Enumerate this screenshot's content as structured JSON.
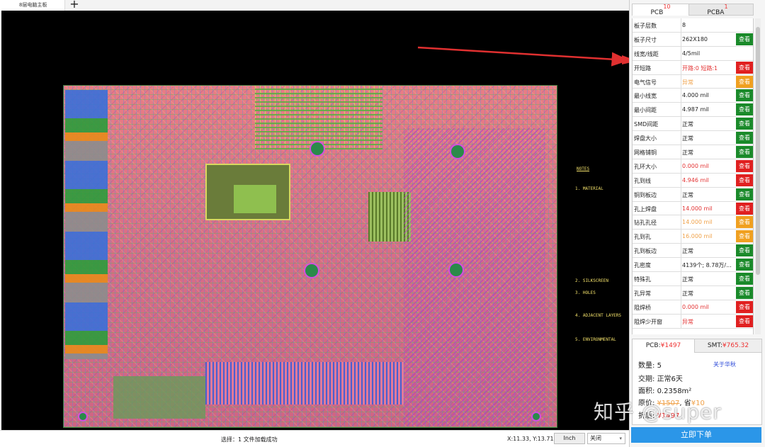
{
  "document_tab": {
    "title": "8层电脑主板"
  },
  "add_tab_label": "+",
  "silkscreen_notes": [
    "NOTES",
    "1. MATERIAL",
    "2. SILKSCREEN",
    "3. HOLES",
    "4. ADJACENT LAYERS",
    "5. ENVIRONMENTAL"
  ],
  "status": {
    "message": "选择：1  文件加载成功",
    "coords": "X:11.33, Y:13.71",
    "unit_button": "Inch",
    "dropdown_value": "关闭",
    "dropdown_arrow": "▾"
  },
  "panel_tabs": [
    {
      "label": "PCB",
      "count": "10"
    },
    {
      "label": "PCBA",
      "count": "1"
    }
  ],
  "check_rows": [
    {
      "label": "板子层数",
      "value": "8",
      "value_color": "#222222",
      "button": "",
      "button_color": ""
    },
    {
      "label": "板子尺寸",
      "value": "262X180",
      "value_color": "#222222",
      "button": "查看",
      "button_color": "#1a8a2a"
    },
    {
      "label": "线宽/线距",
      "value": "4/5mil",
      "value_color": "#222222",
      "button": "",
      "button_color": ""
    },
    {
      "label": "开短路",
      "value": "开路:0  短路:1",
      "value_color": "#e33333",
      "button": "查看",
      "button_color": "#e02020"
    },
    {
      "label": "电气信号",
      "value": "异常",
      "value_color": "#f0a24a",
      "button": "查看",
      "button_color": "#f0a020"
    },
    {
      "label": "最小线宽",
      "value": "4.000 mil",
      "value_color": "#222222",
      "button": "查看",
      "button_color": "#1a8a2a"
    },
    {
      "label": "最小间距",
      "value": "4.987 mil",
      "value_color": "#222222",
      "button": "查看",
      "button_color": "#1a8a2a"
    },
    {
      "label": "SMD间距",
      "value": "正常",
      "value_color": "#222222",
      "button": "查看",
      "button_color": "#1a8a2a"
    },
    {
      "label": "焊盘大小",
      "value": "正常",
      "value_color": "#222222",
      "button": "查看",
      "button_color": "#1a8a2a"
    },
    {
      "label": "网格铺铜",
      "value": "正常",
      "value_color": "#222222",
      "button": "查看",
      "button_color": "#1a8a2a"
    },
    {
      "label": "孔环大小",
      "value": "0.000 mil",
      "value_color": "#e33333",
      "button": "查看",
      "button_color": "#e02020"
    },
    {
      "label": "孔到线",
      "value": "4.946 mil",
      "value_color": "#e33333",
      "button": "查看",
      "button_color": "#e02020"
    },
    {
      "label": "铜到板边",
      "value": "正常",
      "value_color": "#222222",
      "button": "查看",
      "button_color": "#1a8a2a"
    },
    {
      "label": "孔上焊盘",
      "value": "14.000 mil",
      "value_color": "#e33333",
      "button": "查看",
      "button_color": "#e02020"
    },
    {
      "label": "钻孔孔径",
      "value": "14.000 mil",
      "value_color": "#f0a24a",
      "button": "查看",
      "button_color": "#f0a020"
    },
    {
      "label": "孔到孔",
      "value": "16.000 mil",
      "value_color": "#f0a24a",
      "button": "查看",
      "button_color": "#f0a020"
    },
    {
      "label": "孔到板边",
      "value": "正常",
      "value_color": "#222222",
      "button": "查看",
      "button_color": "#1a8a2a"
    },
    {
      "label": "孔密度",
      "value": "4139个; 8.78万/...",
      "value_color": "#222222",
      "button": "查看",
      "button_color": "#1a8a2a"
    },
    {
      "label": "特殊孔",
      "value": "正常",
      "value_color": "#222222",
      "button": "查看",
      "button_color": "#1a8a2a"
    },
    {
      "label": "孔异常",
      "value": "正常",
      "value_color": "#222222",
      "button": "查看",
      "button_color": "#1a8a2a"
    },
    {
      "label": "阻焊桥",
      "value": "0.000 mil",
      "value_color": "#e33333",
      "button": "查看",
      "button_color": "#e02020"
    },
    {
      "label": "阻焊少开窗",
      "value": "异常",
      "value_color": "#e33333",
      "button": "查看",
      "button_color": "#e02020"
    }
  ],
  "price": {
    "tab_pcb_label": "PCB:",
    "tab_pcb_value": "¥1497",
    "tab_smt_label": "SMT:",
    "tab_smt_value": "¥765.32",
    "quantity_label": "数量:",
    "quantity": "5",
    "about_link": "关于华秋",
    "delivery_label": "交期:",
    "delivery": "正常6天",
    "area_label": "面积:",
    "area": "0.2358m²",
    "orig_label": "原价:",
    "orig_price": "¥1507",
    "save_label": "省",
    "save_amount": "¥10",
    "final_label": "折后:",
    "final_price": "¥1497",
    "order_button": "立即下单"
  },
  "watermark": "知乎 @super"
}
